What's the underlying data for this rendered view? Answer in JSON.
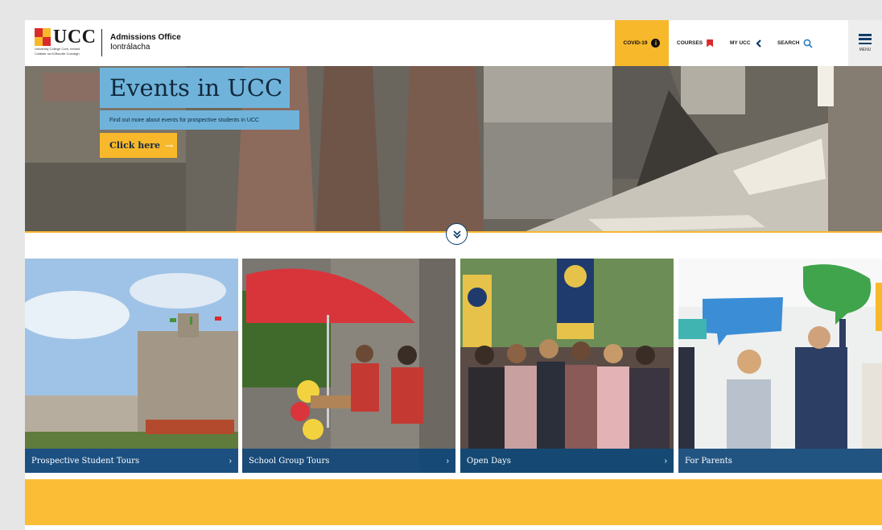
{
  "header": {
    "logo_text": "UCC",
    "logo_subtitle": "University College Cork, Ireland",
    "logo_subtitle_irish": "Coláiste na hOllscoile Corcaigh",
    "office_title": "Admissions Office",
    "office_subtitle": "Iontrálacha"
  },
  "nav": {
    "covid_label": "COVID-19",
    "courses_label": "COURSES",
    "myucc_label": "MY UCC",
    "search_label": "SEARCH",
    "menu_label": "MENU"
  },
  "hero": {
    "title": "Events in UCC",
    "description": "Find out more about events for prospective students in UCC",
    "cta_label": "Click here",
    "cta_arrow": "→"
  },
  "cards": [
    {
      "title": "Prospective Student Tours",
      "chevron": "›"
    },
    {
      "title": "School Group Tours",
      "chevron": "›"
    },
    {
      "title": "Open Days",
      "chevron": "›"
    },
    {
      "title": "For Parents",
      "chevron": ""
    }
  ],
  "colors": {
    "brand_blue": "#0d3d6b",
    "accent_gold": "#f8b82b",
    "hero_label_blue": "#6fb3da",
    "card_bar_blue": "#104678"
  },
  "icons": {
    "covid": "info-icon",
    "courses": "bookmark-icon",
    "myucc": "chevron-left-icon",
    "search": "search-icon",
    "menu": "hamburger-icon",
    "scroll": "double-chevron-down-icon"
  }
}
